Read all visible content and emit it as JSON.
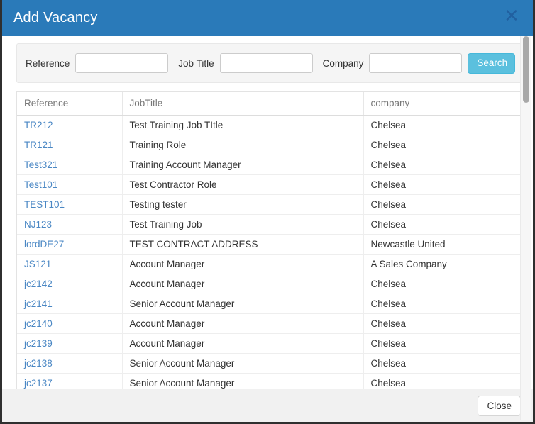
{
  "window": {
    "title": "Add Vacancy",
    "close_icon": "close-x-icon",
    "header_color": "#2a7ab9"
  },
  "search": {
    "reference": {
      "label": "Reference",
      "value": "",
      "placeholder": ""
    },
    "job_title": {
      "label": "Job Title",
      "value": "",
      "placeholder": ""
    },
    "company": {
      "label": "Company",
      "value": "",
      "placeholder": ""
    },
    "search_button": "Search",
    "search_button_color": "#5bc0de"
  },
  "table": {
    "columns": [
      "Reference",
      "JobTitle",
      "company"
    ],
    "rows": [
      {
        "reference": "TR212",
        "job_title": "Test Training Job TItle",
        "company": "Chelsea"
      },
      {
        "reference": "TR121",
        "job_title": "Training Role",
        "company": "Chelsea"
      },
      {
        "reference": "Test321",
        "job_title": "Training Account Manager",
        "company": "Chelsea"
      },
      {
        "reference": "Test101",
        "job_title": "Test Contractor Role",
        "company": "Chelsea"
      },
      {
        "reference": "TEST101",
        "job_title": "Testing tester",
        "company": "Chelsea"
      },
      {
        "reference": "NJ123",
        "job_title": "Test Training Job",
        "company": "Chelsea"
      },
      {
        "reference": "lordDE27",
        "job_title": "TEST CONTRACT ADDRESS",
        "company": "Newcastle United"
      },
      {
        "reference": "JS121",
        "job_title": "Account Manager",
        "company": "A Sales Company"
      },
      {
        "reference": "jc2142",
        "job_title": "Account Manager",
        "company": "Chelsea"
      },
      {
        "reference": "jc2141",
        "job_title": "Senior Account Manager",
        "company": "Chelsea"
      },
      {
        "reference": "jc2140",
        "job_title": "Account Manager",
        "company": "Chelsea"
      },
      {
        "reference": "jc2139",
        "job_title": "Account Manager",
        "company": "Chelsea"
      },
      {
        "reference": "jc2138",
        "job_title": "Senior Account Manager",
        "company": "Chelsea"
      },
      {
        "reference": "jc2137",
        "job_title": "Senior Account Manager",
        "company": "Chelsea"
      }
    ],
    "link_color": "#4a87c4"
  },
  "footer": {
    "close_label": "Close"
  }
}
